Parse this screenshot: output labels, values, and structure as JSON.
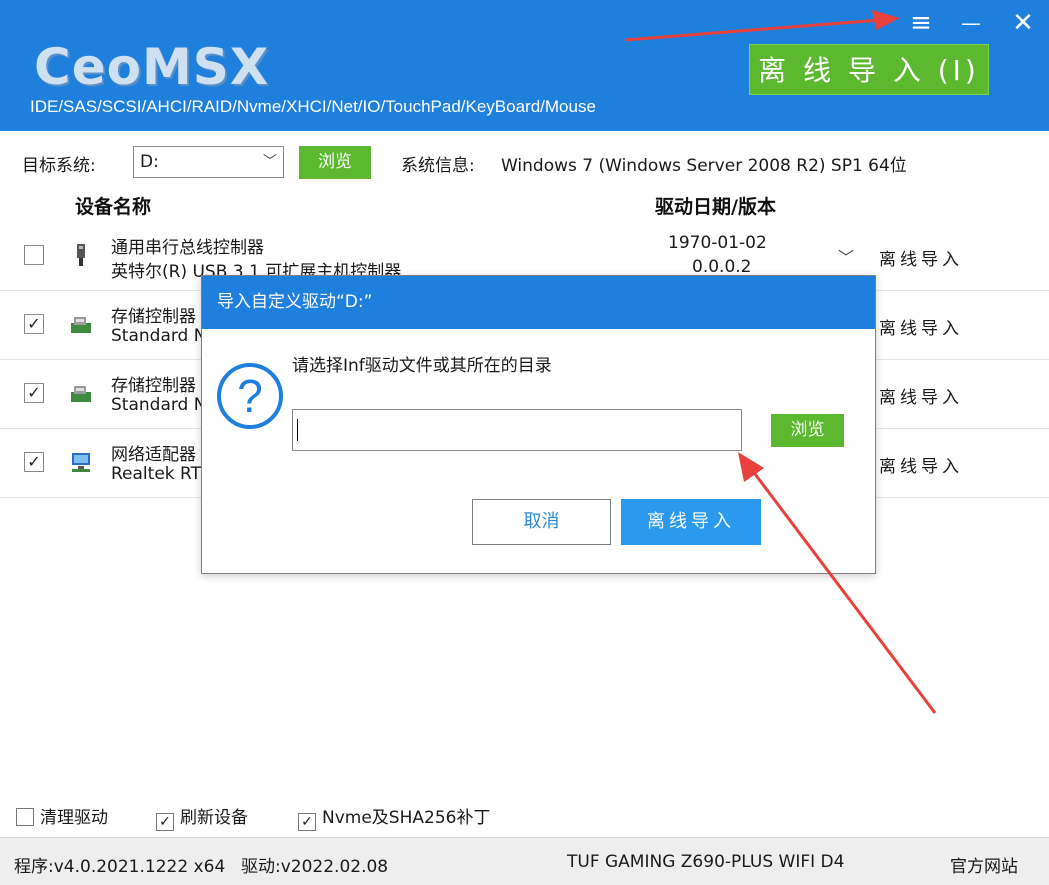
{
  "header": {
    "logo": "CeoMSX",
    "subtitle": "IDE/SAS/SCSI/AHCI/RAID/Nvme/XHCI/Net/IO/TouchPad/KeyBoard/Mouse",
    "menu_icon": "≡",
    "minimize_icon": "—",
    "close_icon": "✕",
    "offline_import_label": "离 线 导 入 (I)",
    "brand_color": "#1e7fdc"
  },
  "target": {
    "label": "目标系统:",
    "value": "D:",
    "browse_label": "浏览",
    "sysinfo_label": "系统信息:",
    "sysinfo_value": "Windows 7 (Windows Server 2008 R2) SP1   64位"
  },
  "table": {
    "col_name": "设备名称",
    "col_date": "驱动日期/版本",
    "rows": [
      {
        "checked": false,
        "icon": "usb-icon",
        "line1": "通用串行总线控制器",
        "line2": "英特尔(R) USB 3.1 可扩展主机控制器",
        "date": "1970-01-02",
        "version": "0.0.0.2",
        "action": "离线导入"
      },
      {
        "checked": true,
        "icon": "storage-controller-icon",
        "line1": "存储控制器",
        "line2": "Standard N",
        "date": "",
        "version": "",
        "action": "离线导入"
      },
      {
        "checked": true,
        "icon": "storage-controller-icon",
        "line1": "存储控制器",
        "line2": "Standard N",
        "date": "",
        "version": "",
        "action": "离线导入"
      },
      {
        "checked": true,
        "icon": "network-adapter-icon",
        "line1": "网络适配器",
        "line2": "Realtek RT",
        "date": "",
        "version": "",
        "action": "离线导入"
      }
    ]
  },
  "options": {
    "clean_driver": "清理驱动",
    "refresh_devices": "刷新设备",
    "nvme_patch": "Nvme及SHA256补丁"
  },
  "status": {
    "program": "程序:v4.0.2021.1222 x64",
    "driver": "驱动:v2022.02.08",
    "board": "TUF GAMING Z690-PLUS WIFI D4",
    "website": "官方网站"
  },
  "dialog": {
    "title": "导入自定义驱动“D:”",
    "icon": "question-icon",
    "icon_glyph": "?",
    "prompt": "请选择Inf驱动文件或其所在的目录",
    "path_value": "",
    "browse_label": "浏览",
    "cancel_label": "取消",
    "import_label": "离线导入"
  },
  "annotation_color": "#e8403a"
}
